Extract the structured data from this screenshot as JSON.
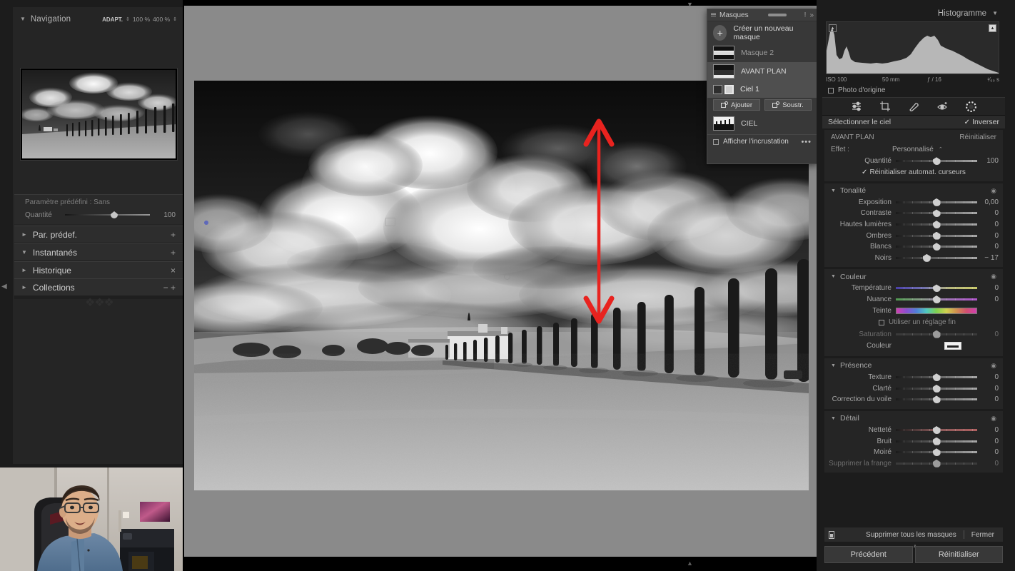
{
  "left": {
    "navigation": {
      "title": "Navigation",
      "fit_label": "ADAPT.",
      "zoom1": "100 %",
      "zoom2": "400 %"
    },
    "preset": {
      "label": "Paramètre prédéfini : Sans",
      "amount_label": "Quantité",
      "amount_value": "100"
    },
    "sections": [
      {
        "name": "Par. prédef.",
        "expanded": false,
        "action": "+"
      },
      {
        "name": "Instantanés",
        "expanded": true,
        "action": "+"
      },
      {
        "name": "Historique",
        "expanded": false,
        "action": "×"
      },
      {
        "name": "Collections",
        "expanded": false,
        "action": "−  +"
      }
    ]
  },
  "masks": {
    "title": "Masques",
    "new_mask_label": "Créer un nouveau masque",
    "items": [
      {
        "name": "Masque 2",
        "selected": false,
        "dim": true
      },
      {
        "name": "AVANT PLAN",
        "selected": true,
        "dim": false
      },
      {
        "name": "Ciel 1",
        "selected": true,
        "dim": false,
        "sub": true
      },
      {
        "name": "CIEL",
        "selected": false,
        "dim": false
      }
    ],
    "add_label": "Ajouter",
    "subtract_label": "Soustr.",
    "overlay_label": "Afficher l'incrustation",
    "more_glyph": "•••",
    "info_glyph": "!",
    "collapse_glyph": "»"
  },
  "right": {
    "histogram": {
      "title": "Histogramme",
      "iso": "ISO 100",
      "focal": "50 mm",
      "aperture": "ƒ / 16",
      "shutter": "¹⁄₆₀ s",
      "original_label": "Photo d'origine"
    },
    "tools": [
      "sliders-icon",
      "crop-icon",
      "heal-icon",
      "redeye-icon",
      "mask-icon"
    ],
    "sky": {
      "label": "Sélectionner le ciel",
      "invert_label": "Inverser",
      "invert_checked": true
    },
    "mask_header": {
      "name": "AVANT PLAN",
      "reset_label": "Réinitialiser",
      "effect_label": "Effet :",
      "effect_value": "Personnalisé",
      "amount_label": "Quantité",
      "amount_value": "100",
      "autoreset_label": "Réinitialiser automat. curseurs",
      "autoreset_checked": true
    },
    "sections": [
      {
        "name": "Tonalité",
        "sliders": [
          {
            "label": "Exposition",
            "value": "0,00",
            "pos": 50,
            "style": "normal"
          },
          {
            "label": "Contraste",
            "value": "0",
            "pos": 50,
            "style": "normal"
          },
          {
            "label": "Hautes lumières",
            "value": "0",
            "pos": 50,
            "style": "normal"
          },
          {
            "label": "Ombres",
            "value": "0",
            "pos": 50,
            "style": "normal"
          },
          {
            "label": "Blancs",
            "value": "0",
            "pos": 50,
            "style": "normal"
          },
          {
            "label": "Noirs",
            "value": "− 17",
            "pos": 38,
            "style": "normal"
          }
        ]
      },
      {
        "name": "Couleur",
        "sliders": [
          {
            "label": "Température",
            "value": "0",
            "pos": 50,
            "style": "grad-temp"
          },
          {
            "label": "Nuance",
            "value": "0",
            "pos": 50,
            "style": "grad-nuance"
          }
        ],
        "teinte_label": "Teinte",
        "fine_label": "Utiliser un réglage fin",
        "saturation": {
          "label": "Saturation",
          "value": "0",
          "pos": 50
        },
        "color_label": "Couleur"
      },
      {
        "name": "Présence",
        "sliders": [
          {
            "label": "Texture",
            "value": "0",
            "pos": 50,
            "style": "normal"
          },
          {
            "label": "Clarté",
            "value": "0",
            "pos": 50,
            "style": "normal"
          },
          {
            "label": "Correction du voile",
            "value": "0",
            "pos": 50,
            "style": "normal"
          }
        ]
      },
      {
        "name": "Détail",
        "sliders": [
          {
            "label": "Netteté",
            "value": "0",
            "pos": 50,
            "style": "grad-sharp"
          },
          {
            "label": "Bruit",
            "value": "0",
            "pos": 50,
            "style": "normal"
          },
          {
            "label": "Moiré",
            "value": "0",
            "pos": 50,
            "style": "normal"
          },
          {
            "label": "Supprimer la frange",
            "value": "0",
            "pos": 50,
            "style": "normal",
            "dim": true
          }
        ]
      }
    ],
    "bottom": {
      "delete_all_label": "Supprimer tous les masques",
      "close_label": "Fermer"
    },
    "footer": {
      "previous_label": "Précédent",
      "reset_label": "Réinitialiser"
    }
  },
  "annotation": {
    "arrow": "double-headed-vertical-arrow",
    "color": "#e8231f"
  },
  "canvas": {
    "background_color": "#8a8a8a",
    "photo_alt": "Noir et blanc — allée de cyprès en Toscane sous un ciel nuageux"
  }
}
